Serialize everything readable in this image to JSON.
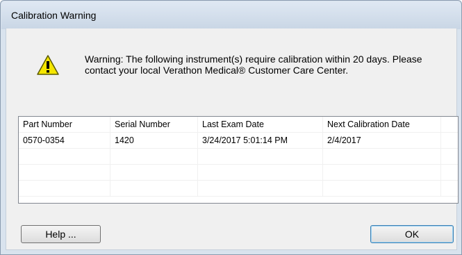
{
  "window": {
    "title": "Calibration Warning"
  },
  "message": "Warning: The following instrument(s) require calibration within 20 days. Please contact your local Verathon Medical® Customer Care Center.",
  "icon": "warning-icon",
  "table": {
    "columns": [
      "Part Number",
      "Serial Number",
      "Last Exam Date",
      "Next Calibration Date"
    ],
    "rows": [
      [
        "0570-0354",
        "1420",
        "3/24/2017 5:01:14 PM",
        "2/4/2017"
      ]
    ]
  },
  "buttons": {
    "help": "Help ...",
    "ok": "OK"
  },
  "colors": {
    "warning_yellow": "#f5e600",
    "titlebar": "#d3deea",
    "ok_border": "#3c7fb1"
  }
}
